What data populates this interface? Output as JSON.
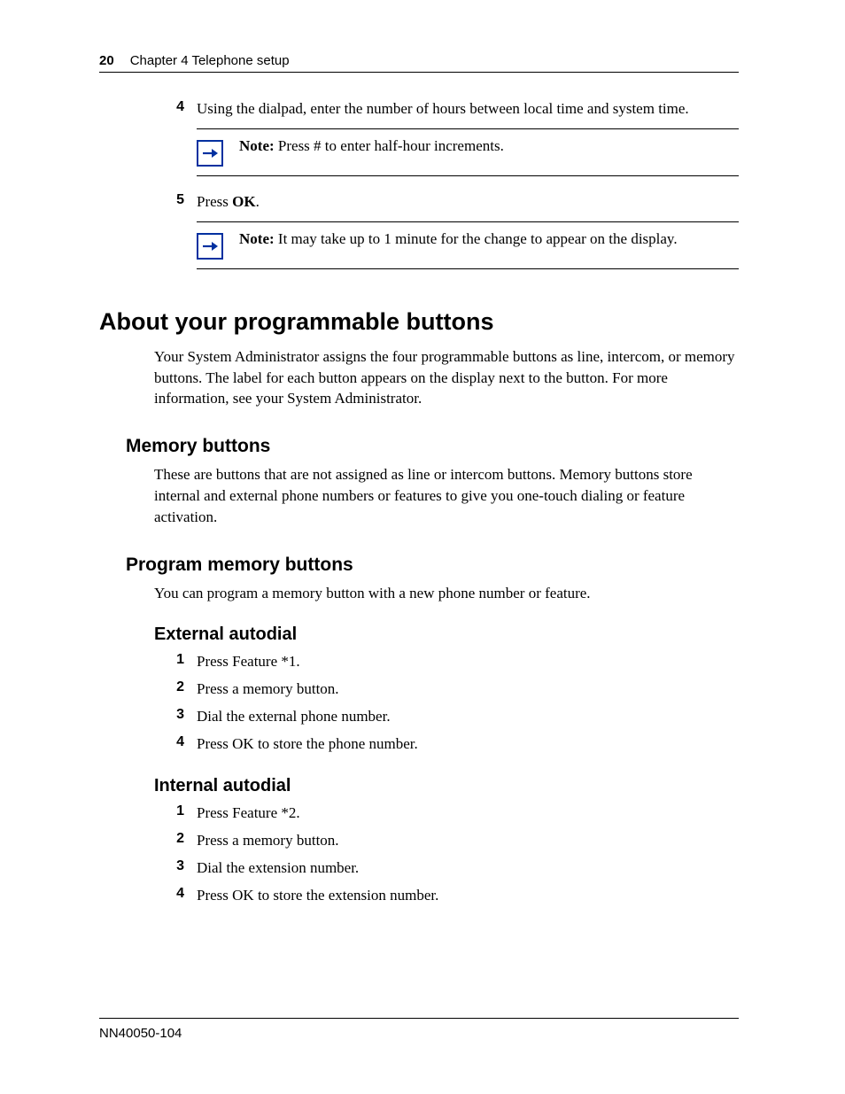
{
  "header": {
    "page_number": "20",
    "chapter": "Chapter 4  Telephone setup"
  },
  "top_steps": {
    "s4": {
      "num": "4",
      "text": "Using the dialpad, enter the number of hours between local time and system time."
    },
    "note1": {
      "label": "Note:",
      "text": " Press # to enter half-hour increments."
    },
    "s5": {
      "num": "5",
      "text_pre": "Press ",
      "bold": "OK",
      "text_post": "."
    },
    "note2": {
      "label": "Note:",
      "text": " It may take up to 1 minute for the change to appear on the display."
    }
  },
  "sections": {
    "h1_about": "About your programmable buttons",
    "about_para": "Your System Administrator assigns the four programmable buttons as line, intercom, or memory buttons. The label for each button appears on the display next to the button. For more information, see your System Administrator.",
    "h2_memory": "Memory buttons",
    "memory_para": "These are buttons that are not assigned as line or intercom buttons. Memory buttons store internal and external phone numbers or features to give you one-touch dialing or feature activation.",
    "h2_program": "Program memory buttons",
    "program_para": "You can program a memory button with a new phone number or feature.",
    "h3_external": "External autodial",
    "external_steps": {
      "s1": {
        "num": "1",
        "text": "Press Feature *1."
      },
      "s2": {
        "num": "2",
        "text": "Press a memory button."
      },
      "s3": {
        "num": "3",
        "text": "Dial the external phone number."
      },
      "s4": {
        "num": "4",
        "text": "Press OK to store the phone number."
      }
    },
    "h3_internal": "Internal autodial",
    "internal_steps": {
      "s1": {
        "num": "1",
        "text": "Press Feature *2."
      },
      "s2": {
        "num": "2",
        "text": "Press a memory button."
      },
      "s3": {
        "num": "3",
        "text": "Dial the extension number."
      },
      "s4": {
        "num": "4",
        "text": "Press OK to store the extension number."
      }
    }
  },
  "footer": {
    "docnum": "NN40050-104"
  }
}
